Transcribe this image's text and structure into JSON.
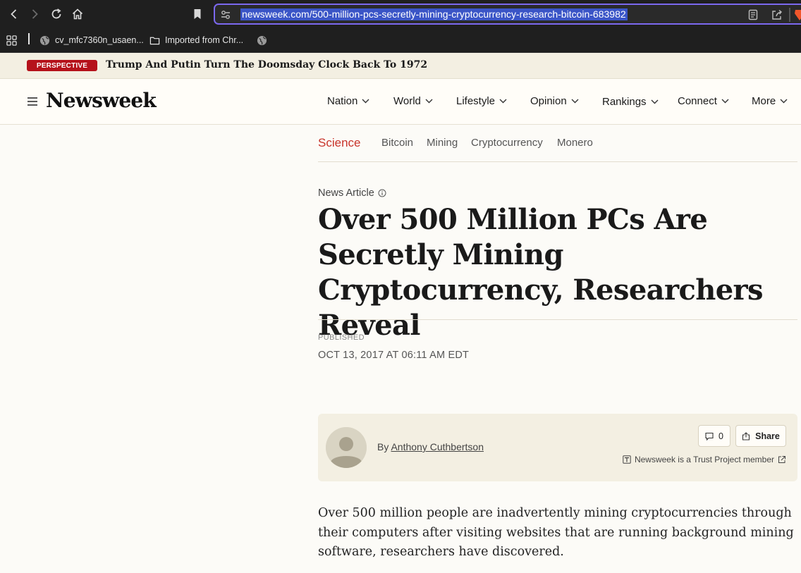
{
  "browser": {
    "url": "newsweek.com/500-million-pcs-secretly-mining-cryptocurrency-research-bitcoin-683982",
    "bookmarks": [
      {
        "label": "cv_mfc7360n_usaen..."
      },
      {
        "label": "Imported from Chr..."
      }
    ]
  },
  "perspective": {
    "badge": "PERSPECTIVE",
    "headline": "Trump And Putin Turn The Doomsday Clock Back To 1972"
  },
  "header": {
    "logo": "Newsweek",
    "nav": [
      "Nation",
      "World",
      "Lifestyle",
      "Opinion",
      "Rankings",
      "Connect",
      "More"
    ]
  },
  "subnav": {
    "primary": "Science",
    "tags": [
      "Bitcoin",
      "Mining",
      "Cryptocurrency",
      "Monero"
    ]
  },
  "article": {
    "type": "News Article",
    "headline": "Over 500 Million PCs Are Secretly Mining Cryptocurrency, Researchers Reveal",
    "published_label": "PUBLISHED",
    "published_date": "OCT 13, 2017 AT 06:11 AM EDT",
    "byline_prefix": "By",
    "author": "Anthony Cuthbertson",
    "comment_count": "0",
    "share_label": "Share",
    "trust": "Newsweek is a Trust Project member",
    "body": "Over 500 million people are inadvertently mining cryptocurrencies through their computers after visiting websites that are running background mining software, researchers have discovered."
  },
  "icons": {
    "back": "chevron-left-icon",
    "forward": "chevron-right-icon",
    "reload": "reload-icon",
    "home": "home-icon",
    "bookmark": "bookmark-icon",
    "site_settings": "tune-icon",
    "reader": "reader-icon",
    "share_page": "share-icon",
    "brave": "brave-lion-icon",
    "apps": "apps-grid-icon",
    "globe": "globe-icon",
    "folder": "folder-icon",
    "menu": "hamburger-icon",
    "chevron": "chevron-down-icon",
    "info": "info-icon",
    "comment": "comment-icon",
    "share": "share-icon",
    "trust": "trust-project-icon",
    "external": "external-link-icon"
  },
  "colors": {
    "accent_red": "#c8332a",
    "badge_red": "#b5121b",
    "url_focus": "#7b68ee"
  }
}
